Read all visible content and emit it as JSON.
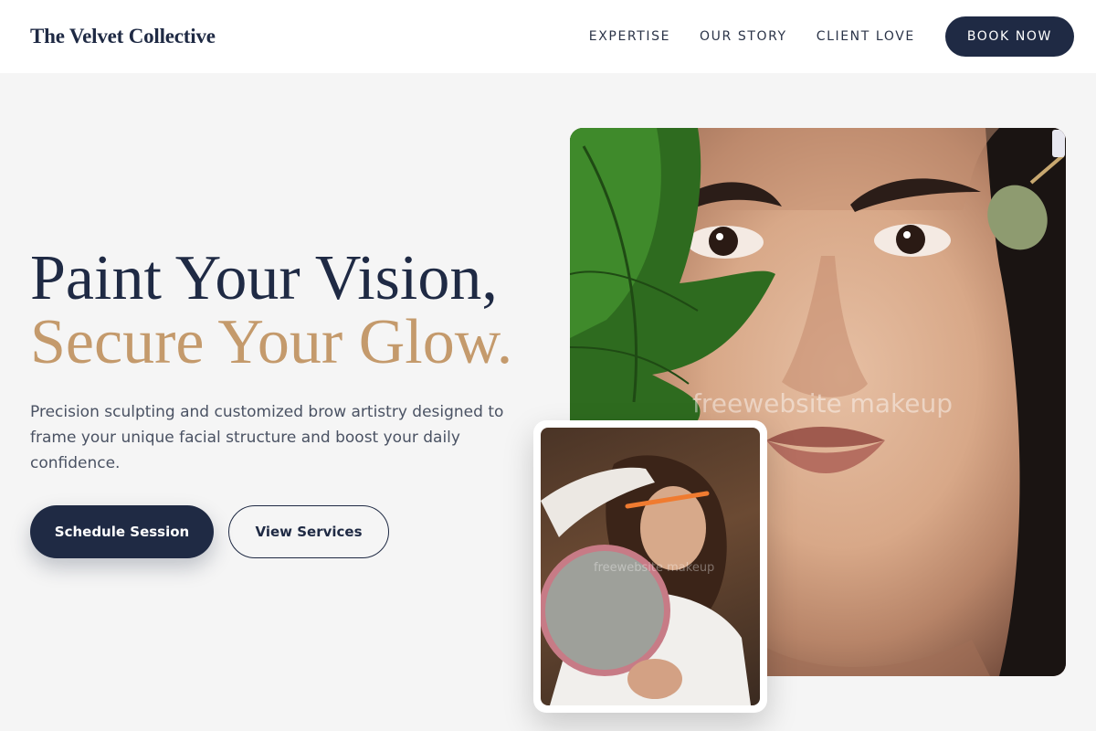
{
  "header": {
    "logo": "The Velvet Collective",
    "nav": [
      {
        "label": "EXPERTISE"
      },
      {
        "label": "OUR STORY"
      },
      {
        "label": "CLIENT LOVE"
      }
    ],
    "book_label": "BOOK NOW"
  },
  "hero": {
    "title_line1": "Paint Your Vision,",
    "title_line2": "Secure Your Glow.",
    "description": "Precision sculpting and customized brow artistry designed to frame your unique facial structure and boost your daily confidence.",
    "primary_label": "Schedule Session",
    "secondary_label": "View Services"
  },
  "images": {
    "main_watermark": "freewebsite makeup",
    "inset_watermark": "freewebsite makeup"
  },
  "colors": {
    "navy": "#1f2a44",
    "gold": "#c49a6c",
    "background": "#f5f5f5"
  }
}
